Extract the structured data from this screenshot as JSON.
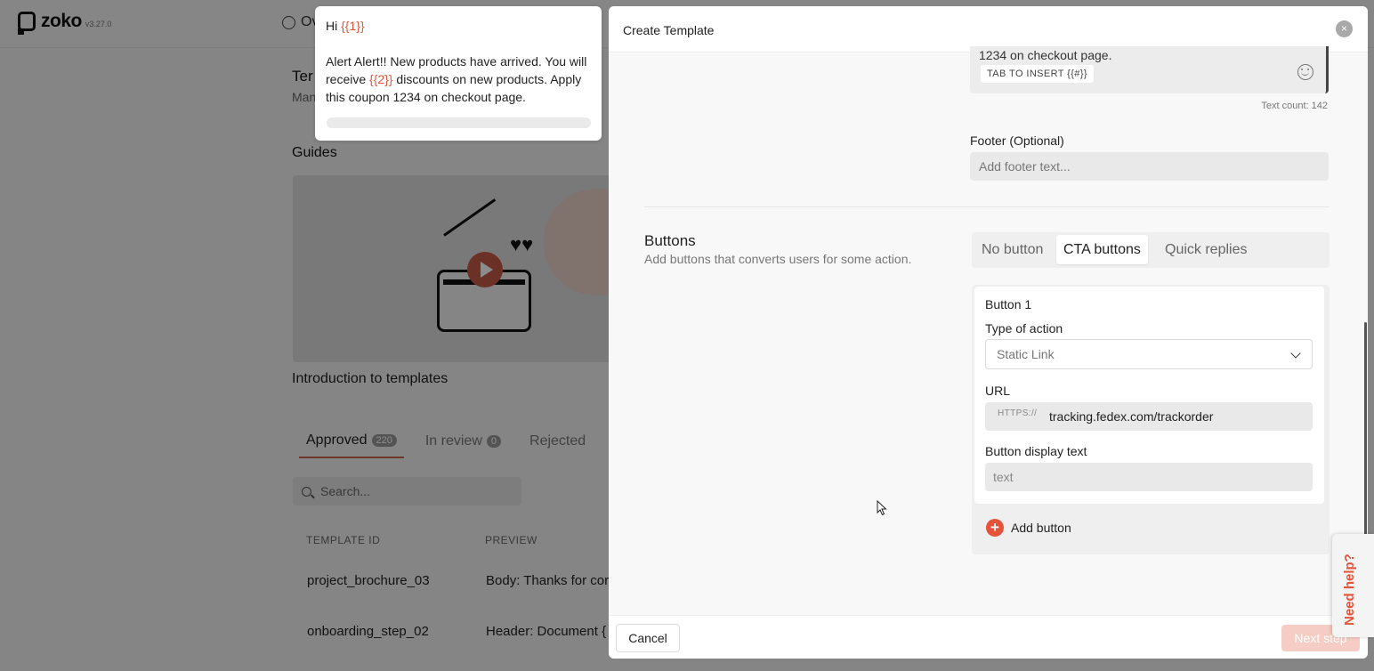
{
  "app": {
    "name": "zoko",
    "version": "v3.27.0",
    "nav_item": "Ov"
  },
  "background": {
    "heading": "Ter",
    "sub": "Man",
    "guides_title": "Guides",
    "video_caption": "Introduction to templates",
    "tabs": [
      {
        "label": "Approved",
        "count": "220"
      },
      {
        "label": "In review",
        "count": "0"
      },
      {
        "label": "Rejected",
        "count": ""
      }
    ],
    "search_placeholder": "Search...",
    "columns": [
      "TEMPLATE ID",
      "PREVIEW"
    ],
    "rows": [
      {
        "id": "project_brochure_03",
        "preview": "Body: Thanks for cor"
      },
      {
        "id": "onboarding_step_02",
        "preview": "Header: Document {"
      }
    ]
  },
  "preview": {
    "greeting_prefix": "Hi ",
    "greeting_var": "{{1}}",
    "body_part1": "Alert Alert!! New products have arrived. You will receive ",
    "body_var": "{{2}}",
    "body_part2": " discounts on new products. Apply this coupon 1234 on checkout page."
  },
  "modal": {
    "title": "Create Template",
    "close_glyph": "×",
    "body_text_end": "1234 on checkout page.",
    "insert_label": "TAB TO INSERT {{#}}",
    "text_count": "Text count: 142",
    "footer_label": "Footer (Optional)",
    "footer_placeholder": "Add footer text...",
    "buttons_title": "Buttons",
    "buttons_desc": "Add buttons that converts users for some action.",
    "button_tabs": [
      "No button",
      "CTA buttons",
      "Quick replies"
    ],
    "active_tab": "CTA buttons",
    "button_card": {
      "title": "Button 1",
      "type_label": "Type of action",
      "type_value": "Static Link",
      "url_label": "URL",
      "url_prefix": "HTTPS://",
      "url_value": "tracking.fedex.com/trackorder",
      "display_label": "Button display text",
      "display_placeholder": "text"
    },
    "add_button_label": "Add button",
    "cancel_label": "Cancel",
    "next_label": "Next step"
  },
  "help": {
    "label": "Need help?"
  },
  "colors": {
    "accent": "#e5533a",
    "variable": "#e2553b"
  }
}
